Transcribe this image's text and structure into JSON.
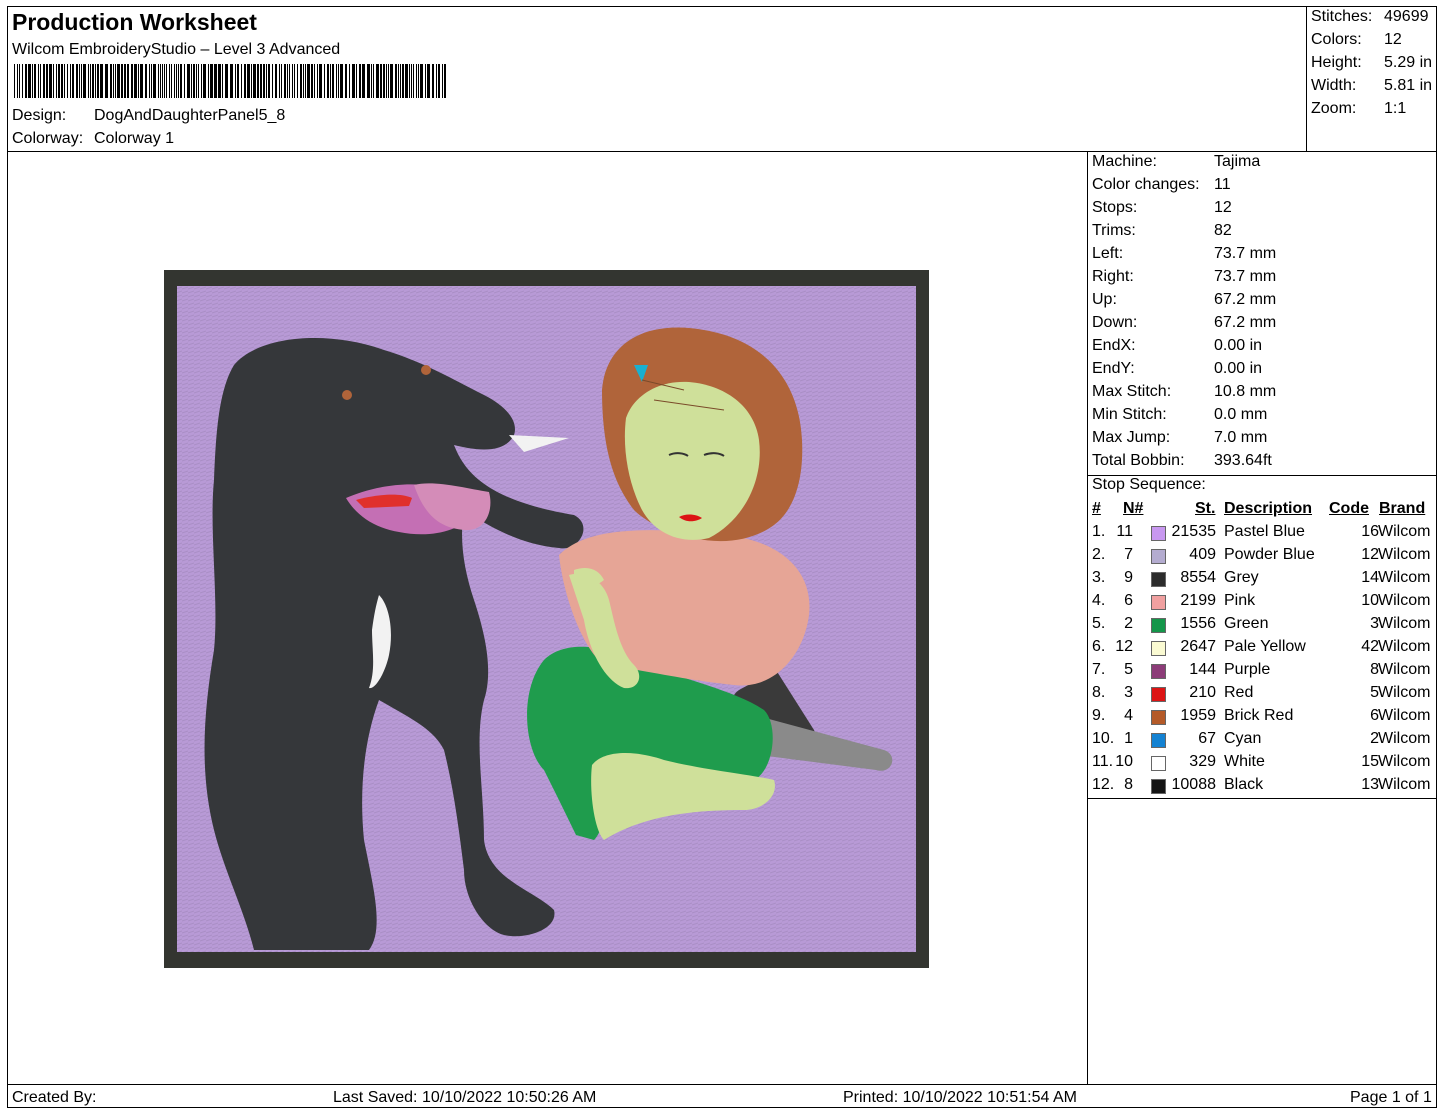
{
  "header": {
    "title": "Production Worksheet",
    "software": "Wilcom EmbroideryStudio – Level 3 Advanced",
    "design_label": "Design:",
    "design_value": "DogAndDaughterPanel5_8",
    "colorway_label": "Colorway:",
    "colorway_value": "Colorway 1"
  },
  "stats": [
    {
      "label": "Stitches:",
      "value": "49699"
    },
    {
      "label": "Colors:",
      "value": "12"
    },
    {
      "label": "Height:",
      "value": "5.29 in"
    },
    {
      "label": "Width:",
      "value": "5.81 in"
    },
    {
      "label": "Zoom:",
      "value": "1:1"
    }
  ],
  "machine_info": [
    {
      "label": "Machine:",
      "value": "Tajima"
    },
    {
      "label": "Color changes:",
      "value": "11"
    },
    {
      "label": "Stops:",
      "value": "12"
    },
    {
      "label": "Trims:",
      "value": "82"
    },
    {
      "label": "Left:",
      "value": "73.7 mm"
    },
    {
      "label": "Right:",
      "value": "73.7 mm"
    },
    {
      "label": "Up:",
      "value": "67.2 mm"
    },
    {
      "label": "Down:",
      "value": "67.2 mm"
    },
    {
      "label": "EndX:",
      "value": "0.00 in"
    },
    {
      "label": "EndY:",
      "value": "0.00 in"
    },
    {
      "label": "Max Stitch:",
      "value": "10.8 mm"
    },
    {
      "label": "Min Stitch:",
      "value": "0.0 mm"
    },
    {
      "label": "Max Jump:",
      "value": "7.0 mm"
    },
    {
      "label": "Total Bobbin:",
      "value": "393.64ft"
    }
  ],
  "stop_sequence": {
    "title": "Stop Sequence:",
    "headers": {
      "idx": "#",
      "n": "N#",
      "st": "St.",
      "desc": "Description",
      "code": "Code",
      "brand": "Brand"
    },
    "rows": [
      {
        "idx": "1.",
        "n": "11",
        "color": "#c898f0",
        "st": "21535",
        "desc": "Pastel Blue",
        "code": "16",
        "brand": "Wilcom"
      },
      {
        "idx": "2.",
        "n": "7",
        "color": "#b4acd0",
        "st": "409",
        "desc": "Powder Blue",
        "code": "12",
        "brand": "Wilcom"
      },
      {
        "idx": "3.",
        "n": "9",
        "color": "#2c2c2c",
        "st": "8554",
        "desc": "Grey",
        "code": "14",
        "brand": "Wilcom"
      },
      {
        "idx": "4.",
        "n": "6",
        "color": "#f0a0a0",
        "st": "2199",
        "desc": "Pink",
        "code": "10",
        "brand": "Wilcom"
      },
      {
        "idx": "5.",
        "n": "2",
        "color": "#14964a",
        "st": "1556",
        "desc": "Green",
        "code": "3",
        "brand": "Wilcom"
      },
      {
        "idx": "6.",
        "n": "12",
        "color": "#fafad2",
        "st": "2647",
        "desc": "Pale Yellow",
        "code": "42",
        "brand": "Wilcom"
      },
      {
        "idx": "7.",
        "n": "5",
        "color": "#8c3c78",
        "st": "144",
        "desc": "Purple",
        "code": "8",
        "brand": "Wilcom"
      },
      {
        "idx": "8.",
        "n": "3",
        "color": "#dc1414",
        "st": "210",
        "desc": "Red",
        "code": "5",
        "brand": "Wilcom"
      },
      {
        "idx": "9.",
        "n": "4",
        "color": "#b45a28",
        "st": "1959",
        "desc": "Brick Red",
        "code": "6",
        "brand": "Wilcom"
      },
      {
        "idx": "10.",
        "n": "1",
        "color": "#1482d2",
        "st": "67",
        "desc": "Cyan",
        "code": "2",
        "brand": "Wilcom"
      },
      {
        "idx": "11.",
        "n": "10",
        "color": "#ffffff",
        "st": "329",
        "desc": "White",
        "code": "15",
        "brand": "Wilcom"
      },
      {
        "idx": "12.",
        "n": "8",
        "color": "#141414",
        "st": "10088",
        "desc": "Black",
        "code": "13",
        "brand": "Wilcom"
      }
    ]
  },
  "footer": {
    "created_by": "Created By:",
    "last_saved": "Last Saved: 10/10/2022 10:50:26 AM",
    "printed": "Printed: 10/10/2022 10:51:54 AM",
    "page": "Page 1 of 1"
  },
  "design_colors": {
    "border": "#333530",
    "background": "#b89ad6",
    "dog": "#35373a",
    "hair": "#b0643a",
    "skin": "#cfe09a",
    "shirt": "#e6a596",
    "shorts": "#1f9c4d",
    "shoe": "#3a3a3a"
  }
}
